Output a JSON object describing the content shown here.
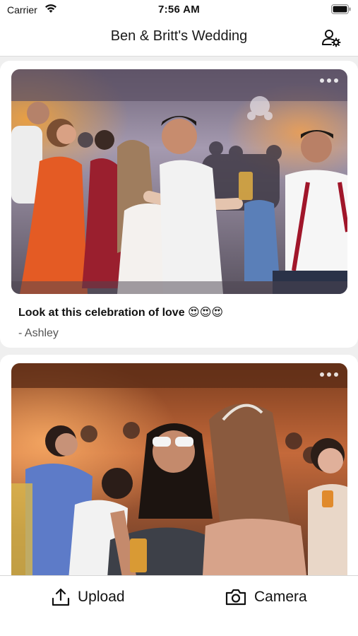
{
  "status_bar": {
    "carrier": "Carrier",
    "time": "7:56 AM"
  },
  "header": {
    "title": "Ben & Britt's Wedding",
    "settings_icon": "user-settings-icon"
  },
  "feed": {
    "posts": [
      {
        "caption": "Look at this celebration of love 😍😍😍",
        "author": "- Ashley",
        "photo": "wedding-dance-hug-photo"
      },
      {
        "caption": "",
        "author": "",
        "photo": "guests-dancing-photo"
      }
    ]
  },
  "toolbar": {
    "upload_label": "Upload",
    "camera_label": "Camera"
  },
  "colors": {
    "background": "#efefef",
    "card": "#ffffff",
    "text": "#111111",
    "secondary_text": "#555555"
  }
}
